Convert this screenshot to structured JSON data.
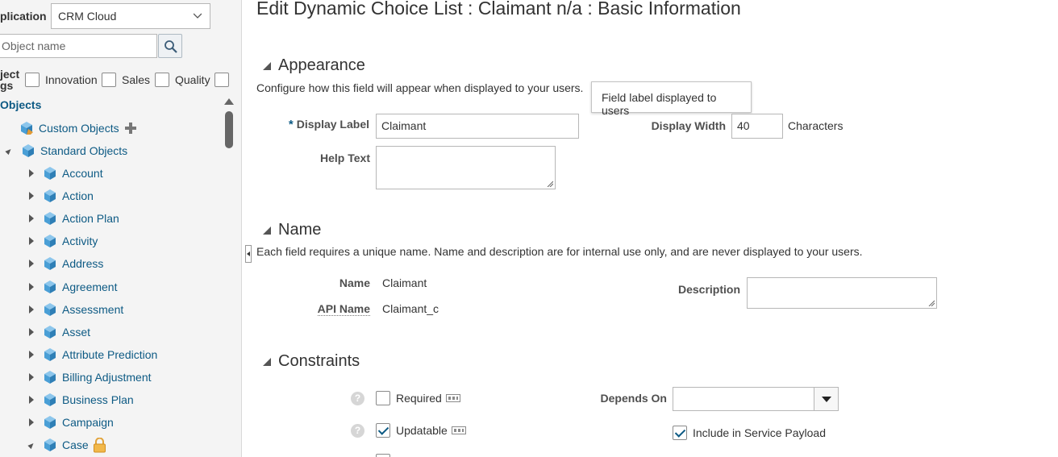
{
  "left_panel": {
    "application_label": "plication",
    "application_value": "CRM Cloud",
    "search_placeholder": "Object name",
    "tags_label_line1": "ject",
    "tags_label_line2": "gs",
    "tags": [
      "Innovation",
      "Sales",
      "Quality"
    ],
    "objects_heading": "Objects",
    "tree": {
      "custom_objects": "Custom Objects",
      "standard_objects": "Standard Objects",
      "items": [
        "Account",
        "Action",
        "Action Plan",
        "Activity",
        "Address",
        "Agreement",
        "Assessment",
        "Asset",
        "Attribute Prediction",
        "Billing Adjustment",
        "Business Plan",
        "Campaign",
        "Case"
      ]
    }
  },
  "main": {
    "title": "Edit Dynamic Choice List : Claimant n/a : Basic Information",
    "appearance": {
      "heading": "Appearance",
      "description": "Configure how this field will appear when displayed to your users.",
      "tooltip": "Field label displayed to users",
      "display_label_label": "Display Label",
      "display_label_value": "Claimant",
      "display_width_label": "Display Width",
      "display_width_value": "40",
      "display_width_unit": "Characters",
      "help_text_label": "Help Text"
    },
    "name": {
      "heading": "Name",
      "description": "Each field requires a unique name. Name and description are for internal use only, and are never displayed to your users.",
      "name_label": "Name",
      "name_value": "Claimant",
      "api_name_label": "API Name",
      "api_name_value": "Claimant_c",
      "description_label": "Description"
    },
    "constraints": {
      "heading": "Constraints",
      "required_label": "Required",
      "updatable_label": "Updatable",
      "depends_on_label": "Depends On",
      "include_payload_label": "Include in Service Payload"
    }
  },
  "colors": {
    "link_blue": "#0d5a84",
    "panel_bg": "#f4f4f4",
    "cube_blue": "#4a9fd6"
  }
}
